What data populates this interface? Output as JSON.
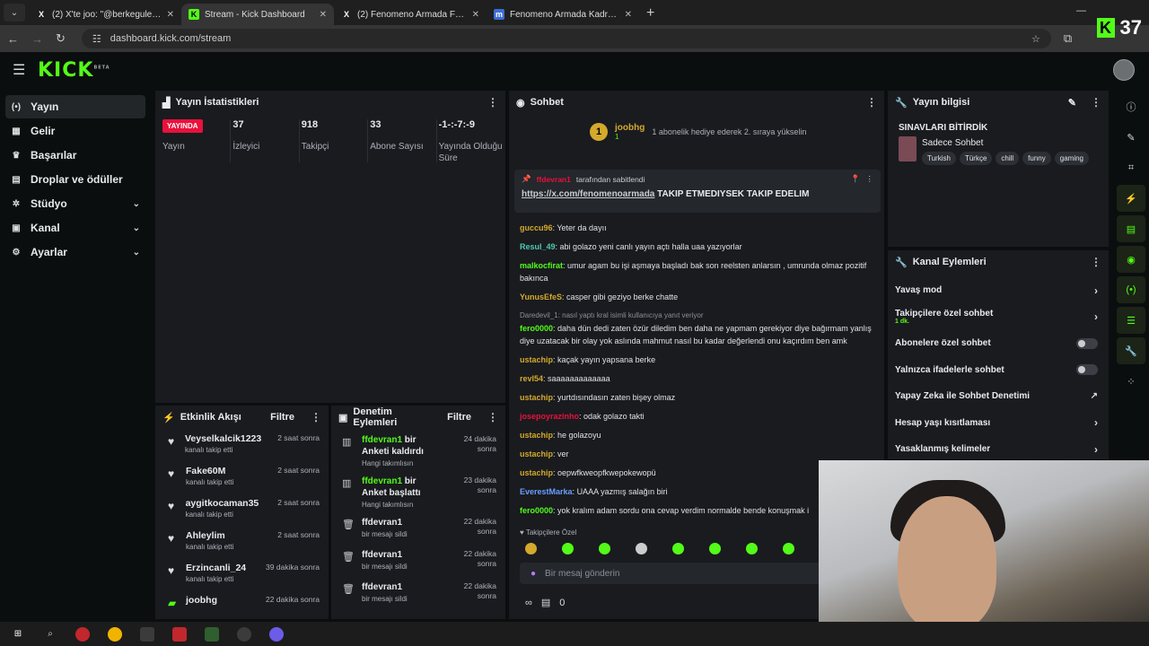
{
  "browser": {
    "tabs": [
      {
        "icon": "X",
        "label": "(2) X'te joo: \"@berkegulerr yine"
      },
      {
        "icon": "K",
        "label": "Stream - Kick Dashboard"
      },
      {
        "icon": "X",
        "label": "(2) Fenomeno Armada Fc (@fen"
      },
      {
        "icon": "m",
        "label": "Fenomeno Armada Kadro | Mac"
      }
    ],
    "url": "dashboard.kick.com/stream"
  },
  "viewer_overlay": {
    "count": "37"
  },
  "sidebar": {
    "items": [
      {
        "icon": "(•)",
        "label": "Yayın"
      },
      {
        "icon": "▦",
        "label": "Gelir"
      },
      {
        "icon": "♛",
        "label": "Başarılar"
      },
      {
        "icon": "▤",
        "label": "Droplar ve ödüller"
      },
      {
        "icon": "✲",
        "label": "Stüdyo"
      },
      {
        "icon": "▣",
        "label": "Kanal"
      },
      {
        "icon": "⚙",
        "label": "Ayarlar"
      }
    ]
  },
  "stats": {
    "title": "Yayın İstatistikleri",
    "live_badge": "YAYINDA",
    "items": [
      {
        "value": "",
        "label": "Yayın"
      },
      {
        "value": "37",
        "label": "İzleyici"
      },
      {
        "value": "918",
        "label": "Takipçi"
      },
      {
        "value": "33",
        "label": "Abone Sayısı"
      },
      {
        "value": "-1-:-7:-9",
        "label": "Yayında Olduğu Süre"
      }
    ]
  },
  "activity": {
    "title": "Etkinlik Akışı",
    "filter": "Filtre",
    "items": [
      {
        "name": "Veyselkalcik1223",
        "sub": "kanalı takip etti",
        "time": "2 saat sonra"
      },
      {
        "name": "Fake60M",
        "sub": "kanalı takip etti",
        "time": "2 saat sonra"
      },
      {
        "name": "aygitkocaman35",
        "sub": "kanalı takip etti",
        "time": "2 saat sonra"
      },
      {
        "name": "Ahleylim",
        "sub": "kanalı takip etti",
        "time": "2 saat sonra"
      },
      {
        "name": "Erzincanli_24",
        "sub": "kanalı takip etti",
        "time": "39 dakika sonra"
      },
      {
        "name": "joobhg",
        "sub": "",
        "time": "22 dakika sonra"
      }
    ]
  },
  "moderation": {
    "title": "Denetim Eylemleri",
    "filter": "Filtre",
    "items": [
      {
        "user": "ffdevran1",
        "action": "bir Anketi kaldırdı",
        "sub": "Hangi takımlısın",
        "time": "24 dakika sonra"
      },
      {
        "user": "ffdevran1",
        "action": "bir Anket başlattı",
        "sub": "Hangi takımlısın",
        "time": "23 dakika sonra"
      },
      {
        "user": "ffdevran1",
        "action": "",
        "sub": "bir mesajı sildi",
        "time": "22 dakika sonra"
      },
      {
        "user": "ffdevran1",
        "action": "",
        "sub": "bir mesajı sildi",
        "time": "22 dakika sonra"
      },
      {
        "user": "ffdevran1",
        "action": "",
        "sub": "bir mesajı sildi",
        "time": "22 dakika sonra"
      }
    ]
  },
  "chat": {
    "title": "Sohbet",
    "gift": {
      "user": "joobhg",
      "level": "1",
      "text": "1 abonelik hediye ederek 2. sıraya yükselin"
    },
    "pinned": {
      "by_user": "ffdevran1",
      "by_text": "tarafından sabitlendi",
      "link": "https://x.com/fenomenoarmada",
      "text": "TAKIP ETMEDIYSEK TAKIP EDELIM"
    },
    "messages": [
      {
        "user": "guccu96",
        "color": "#d4a92c",
        "text": "Yeter da dayıı"
      },
      {
        "user": "Resul_49",
        "color": "#4ec9b0",
        "text": "abi golazo yeni canlı yayın açtı halla uaa yazıyorlar"
      },
      {
        "user": "malkocfirat",
        "color": "#53fc18",
        "text": "umur agam bu işi aşmaya başladı bak son reelsten anlarsın , umrunda olmaz pozitif bakınca"
      },
      {
        "user": "YunusEfeS",
        "color": "#d4a92c",
        "text": "casper gibi geziyo berke chatte"
      },
      {
        "user": "fero0000",
        "color": "#53fc18",
        "text": "daha dün dedi zaten özür diledim ben daha ne yapmam gerekiyor diye bağırmam yanlış diye uzatacak bir olay yok aslında mahmut nasıl bu kadar değerlendi onu kaçırdım ben amk",
        "reply": "Daredevil_1: nasıl yaptı kral isimli kullanıcıya yanıt veriyor"
      },
      {
        "user": "ustachip",
        "color": "#d4a92c",
        "text": "kaçak yayın yapsana berke"
      },
      {
        "user": "revl54",
        "color": "#d4a92c",
        "text": "saaaaaaaaaaaaa"
      },
      {
        "user": "ustachip",
        "color": "#d4a92c",
        "text": "yurtdısındasın zaten bişey olmaz"
      },
      {
        "user": "josepoyrazinho",
        "color": "#e9113c",
        "text": "odak golazo takti"
      },
      {
        "user": "ustachip",
        "color": "#d4a92c",
        "text": "he golazoyu"
      },
      {
        "user": "ustachip",
        "color": "#d4a92c",
        "text": "ver"
      },
      {
        "user": "ustachip",
        "color": "#d4a92c",
        "text": "oepwfkweopfkwepokewopü"
      },
      {
        "user": "EverestMarka",
        "color": "#6b9eff",
        "text": "UAAA yazmış salağın biri"
      },
      {
        "user": "fero0000",
        "color": "#53fc18",
        "text": "yok kralım adam sordu ona cevap verdim normalde bende konuşmak i"
      }
    ],
    "follow_only": "Takipçilere Özel",
    "input_placeholder": "Bir mesaj gönderin",
    "footer_count": "0"
  },
  "stream_info": {
    "title": "Yayın bilgisi",
    "stream_title": "SINAVLARI BİTİRDİK",
    "category": "Sadece Sohbet",
    "tags": [
      "Turkish",
      "Türkçe",
      "chill",
      "funny",
      "gaming"
    ]
  },
  "channel_actions": {
    "title": "Kanal Eylemleri",
    "items": [
      {
        "label": "Yavaş mod",
        "sub": "",
        "control": "arrow"
      },
      {
        "label": "Takipçilere özel sohbet",
        "sub": "1 dk.",
        "control": "arrow"
      },
      {
        "label": "Abonelere özel sohbet",
        "sub": "",
        "control": "toggle"
      },
      {
        "label": "Yalnızca ifadelerle sohbet",
        "sub": "",
        "control": "toggle"
      },
      {
        "label": "Yapay Zeka ile Sohbet Denetimi",
        "sub": "",
        "control": "ext"
      },
      {
        "label": "Hesap yaşı kısıtlaması",
        "sub": "",
        "control": "arrow"
      },
      {
        "label": "Yasaklanmış kelimeler",
        "sub": "",
        "control": "arrow"
      }
    ]
  },
  "colors": {
    "brand": "#53fc18",
    "live": "#e9113c",
    "panel": "#191b1f"
  }
}
